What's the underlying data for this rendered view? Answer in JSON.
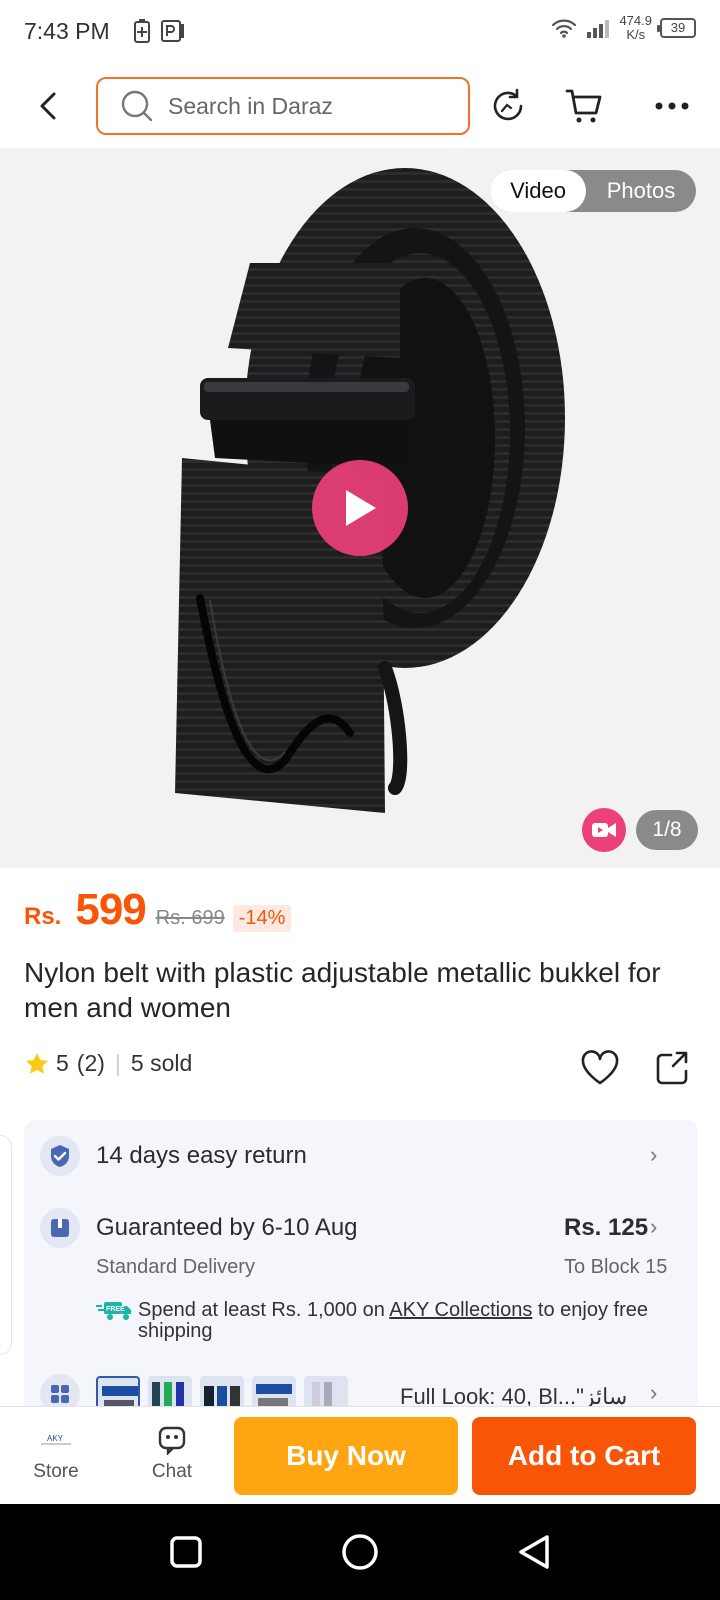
{
  "status_bar": {
    "time": "7:43 PM",
    "net_speed_value": "474.9",
    "net_speed_unit": "K/s",
    "battery_level": "39"
  },
  "header": {
    "search_placeholder": "Search in Daraz"
  },
  "media": {
    "toggle_video": "Video",
    "toggle_photos": "Photos",
    "image_counter": "1/8"
  },
  "product": {
    "currency": "Rs.",
    "price": "599",
    "original_price": "Rs. 699",
    "discount": "-14%",
    "title": "Nylon belt with plastic adjustable metallic bukkel for men and women",
    "rating": "5",
    "review_count": "(2)",
    "sold": "5 sold"
  },
  "info": {
    "return_policy": "14 days easy return",
    "delivery_guarantee": "Guaranteed by 6-10 Aug",
    "delivery_fee": "Rs. 125",
    "delivery_type": "Standard Delivery",
    "delivery_location": "To Block 15",
    "free_shipping_prefix": "Spend at least Rs. 1,000 on ",
    "free_shipping_store": "AKY Collections",
    "free_shipping_suffix": " to enjoy free shipping",
    "free_badge": "FREE",
    "variant_label": "Full Look: 40, Bl...\"سائز"
  },
  "action_bar": {
    "store_label": "Store",
    "chat_label": "Chat",
    "buy_now_label": "Buy Now",
    "add_to_cart_label": "Add to Cart",
    "store_logo_text": "AKY"
  },
  "colors": {
    "accent": "#f85606",
    "buy_now": "#ffa511",
    "search_border": "#f57224",
    "play": "#ec407a"
  }
}
